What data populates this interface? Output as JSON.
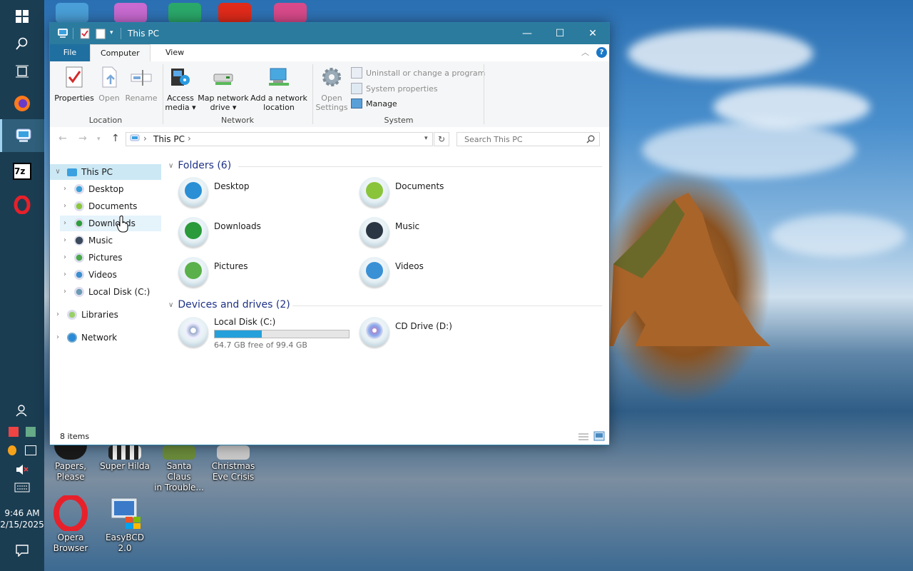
{
  "window": {
    "title": "This PC",
    "controls": {
      "minimize": "—",
      "maximize": "☐",
      "close": "✕"
    }
  },
  "ribbon": {
    "tabs": [
      {
        "label": "File"
      },
      {
        "label": "Computer"
      },
      {
        "label": "View"
      }
    ],
    "location_group": {
      "label": "Location",
      "buttons": [
        {
          "label": "Properties",
          "enabled": true
        },
        {
          "label": "Open",
          "enabled": false
        },
        {
          "label": "Rename",
          "enabled": false
        }
      ]
    },
    "network_group": {
      "label": "Network",
      "buttons": [
        {
          "label_line1": "Access",
          "label_line2": "media ▾"
        },
        {
          "label_line1": "Map network",
          "label_line2": "drive ▾"
        },
        {
          "label_line1": "Add a network",
          "label_line2": "location"
        }
      ]
    },
    "system_group": {
      "label": "System",
      "open_settings_line1": "Open",
      "open_settings_line2": "Settings",
      "items": [
        {
          "label": "Uninstall or change a program",
          "enabled": false
        },
        {
          "label": "System properties",
          "enabled": false
        },
        {
          "label": "Manage",
          "enabled": true
        }
      ]
    }
  },
  "address_bar": {
    "path": "This PC",
    "separator": "›"
  },
  "search": {
    "placeholder": "Search This PC"
  },
  "nav_pane": {
    "root": "This PC",
    "children": [
      {
        "label": "Desktop",
        "color": "#3a9fd8"
      },
      {
        "label": "Documents",
        "color": "#8cc83c"
      },
      {
        "label": "Downloads",
        "color": "#2e9e3c"
      },
      {
        "label": "Music",
        "color": "#3a4a5a"
      },
      {
        "label": "Pictures",
        "color": "#4aa84a"
      },
      {
        "label": "Videos",
        "color": "#3a8fd0"
      },
      {
        "label": "Local Disk (C:)",
        "color": "#6a9ab4"
      }
    ],
    "libraries": "Libraries",
    "network": "Network"
  },
  "content": {
    "folders_header": "Folders (6)",
    "folders": [
      {
        "label": "Desktop",
        "color": "#2a8fd4"
      },
      {
        "label": "Documents",
        "color": "#8ac43a"
      },
      {
        "label": "Downloads",
        "color": "#2a9a3a"
      },
      {
        "label": "Music",
        "color": "#2a3644"
      },
      {
        "label": "Pictures",
        "color": "#5ab04a"
      },
      {
        "label": "Videos",
        "color": "#3a90d4"
      }
    ],
    "drives_header": "Devices and drives (2)",
    "drives": [
      {
        "label": "Local Disk (C:)",
        "free_text": "64.7 GB free of 99.4 GB",
        "used_fraction": 0.35
      },
      {
        "label": "CD Drive (D:)"
      }
    ]
  },
  "status_bar": {
    "item_count": "8 items"
  },
  "desktop_icons": [
    {
      "label_line1": "Papers,",
      "label_line2": "Please"
    },
    {
      "label_line1": "Super Hilda",
      "label_line2": ""
    },
    {
      "label_line1": "Santa Claus",
      "label_line2": "in Trouble..."
    },
    {
      "label_line1": "Christmas",
      "label_line2": "Eve Crisis"
    },
    {
      "label_line1": "Opera",
      "label_line2": "Browser"
    },
    {
      "label_line1": "EasyBCD 2.0",
      "label_line2": ""
    }
  ],
  "taskbar": {
    "time": "9:46 AM",
    "date": "2/15/2025",
    "pinned_7z": "7z"
  },
  "colors": {
    "titlebar": "#2b7b9e",
    "taskbar": "#1b3d52",
    "accent": "#26a0da",
    "section_heading": "#1e3287"
  }
}
